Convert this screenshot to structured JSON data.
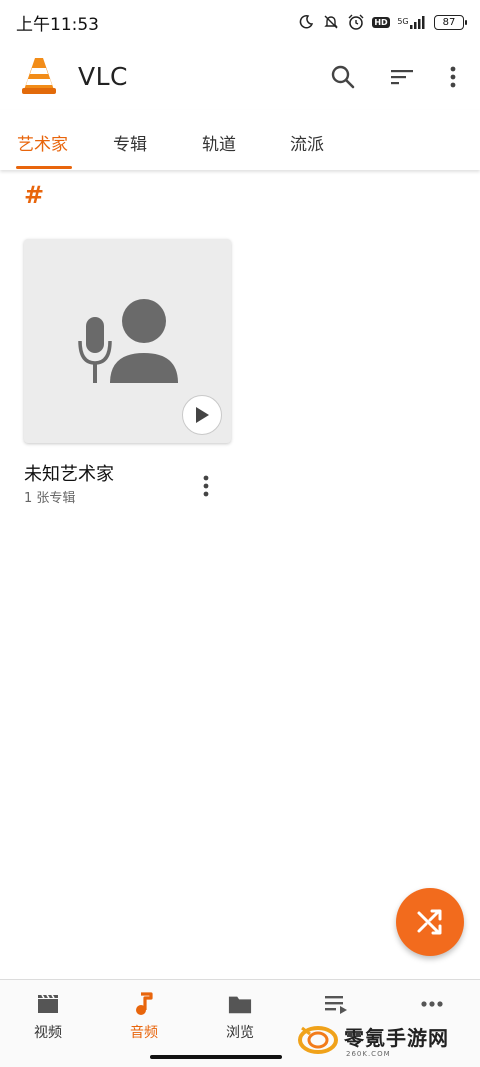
{
  "status": {
    "time": "上午11:53",
    "network": "5G",
    "hd": "HD",
    "battery": "87"
  },
  "app": {
    "title": "VLC"
  },
  "tabs": [
    {
      "label": "艺术家",
      "active": true
    },
    {
      "label": "专辑",
      "active": false
    },
    {
      "label": "轨道",
      "active": false
    },
    {
      "label": "流派",
      "active": false
    }
  ],
  "section_letter": "#",
  "artists": [
    {
      "name": "未知艺术家",
      "subtitle": "1 张专辑"
    }
  ],
  "bottom_nav": [
    {
      "label": "视频",
      "icon": "movie-icon",
      "active": false
    },
    {
      "label": "音频",
      "icon": "music-note-icon",
      "active": true
    },
    {
      "label": "浏览",
      "icon": "folder-icon",
      "active": false
    },
    {
      "label": "",
      "icon": "playlist-icon",
      "active": false
    },
    {
      "label": "",
      "icon": "more-horiz-icon",
      "active": false
    }
  ],
  "watermark": {
    "text": "零氪手游网",
    "sub": "260K.COM"
  },
  "colors": {
    "accent": "#e8650c",
    "fab": "#f26b1d"
  }
}
